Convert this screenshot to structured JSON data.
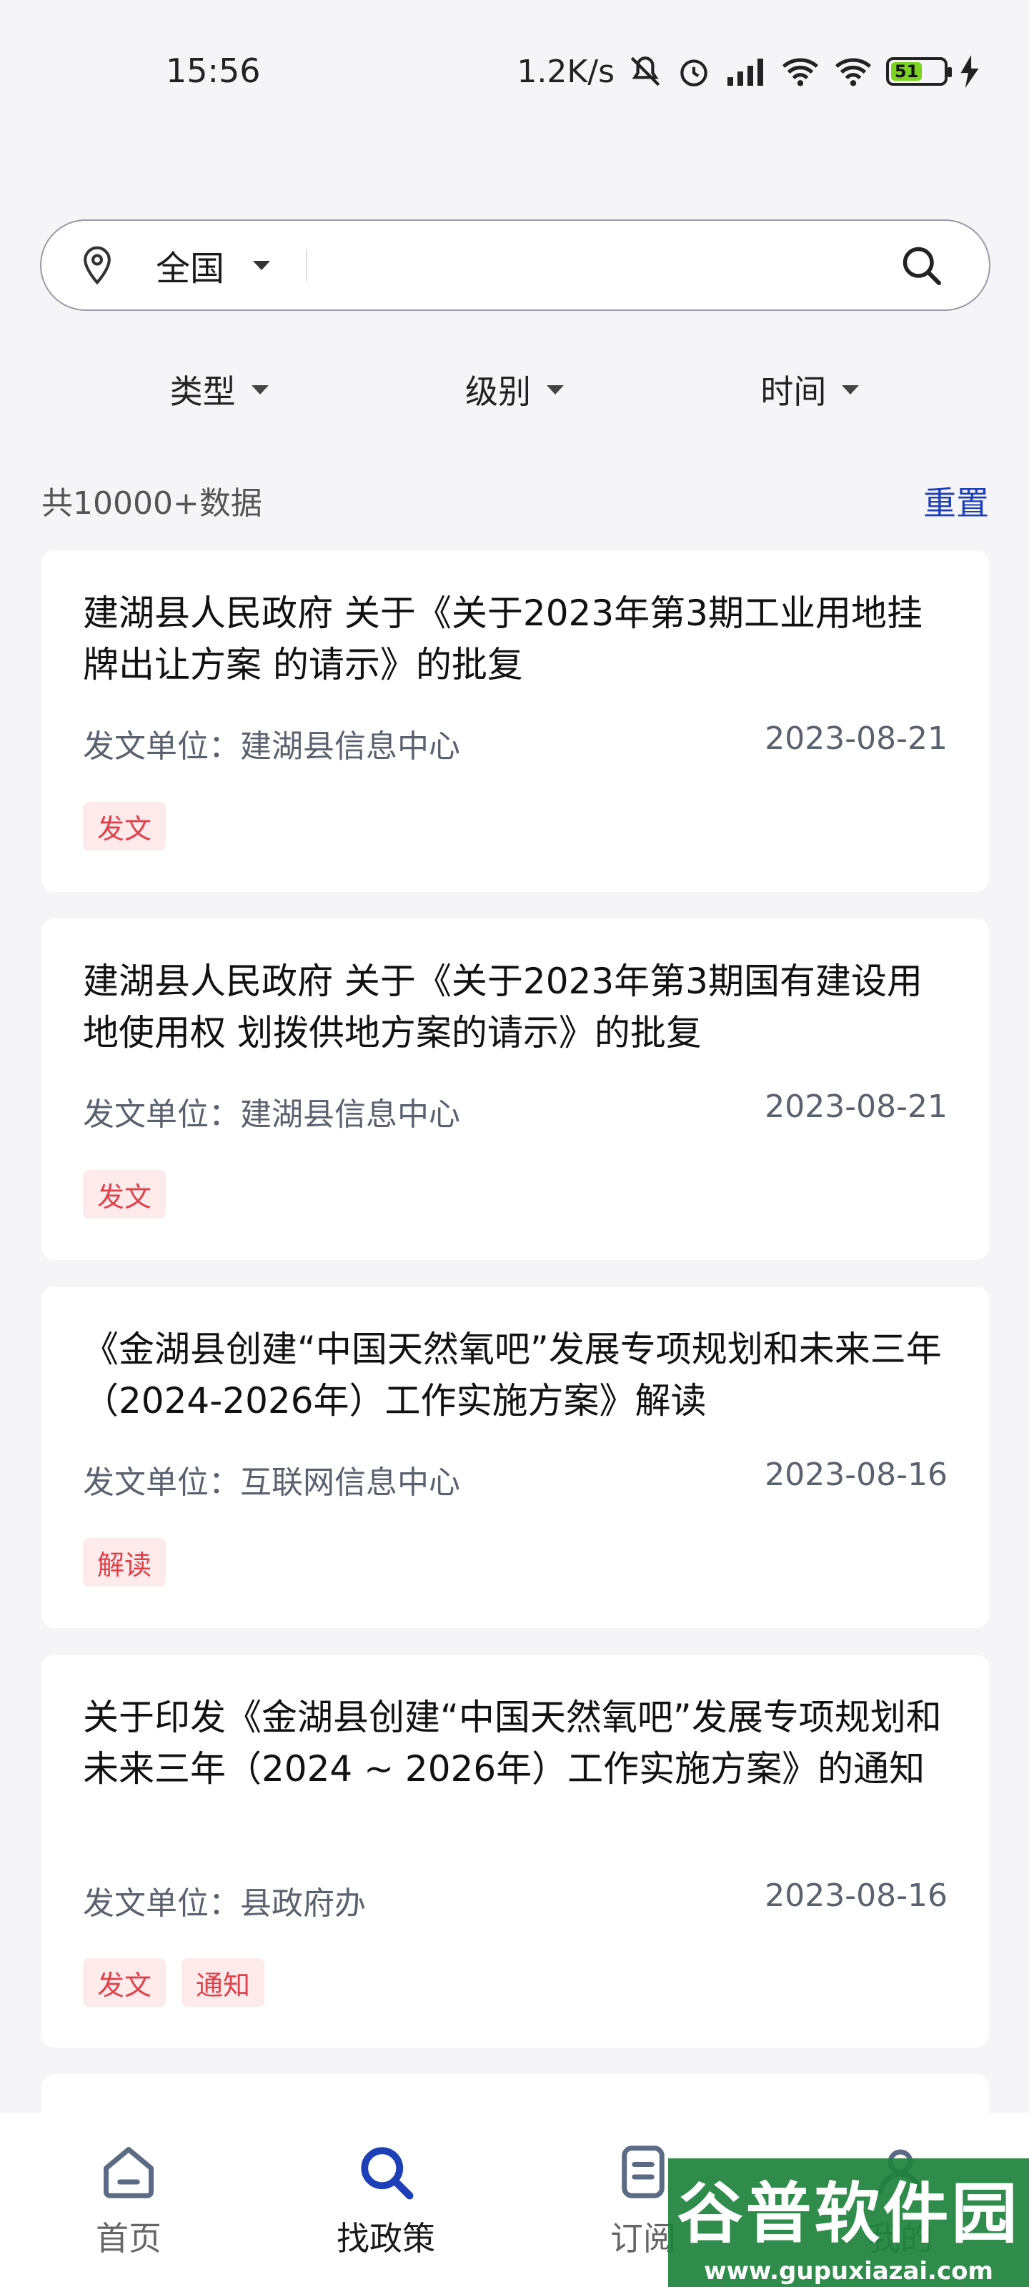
{
  "status_bar": {
    "time": "15:56",
    "speed": "1.2K/s",
    "battery": "51",
    "icons": [
      "mute-icon",
      "alarm-icon",
      "hd-signal-icon",
      "wifi-icon",
      "wifi-icon",
      "battery-icon",
      "charging-icon"
    ]
  },
  "search": {
    "region": "全国",
    "placeholder": "",
    "icon": "search-icon"
  },
  "filters": [
    {
      "label": "类型"
    },
    {
      "label": "级别"
    },
    {
      "label": "时间"
    }
  ],
  "summary": {
    "count_text": "共10000+数据",
    "reset_label": "重置"
  },
  "cards": [
    {
      "title": "建湖县人民政府 关于《关于2023年第3期工业用地挂牌出让方案 的请示》的批复",
      "issuer": "发文单位：建湖县信息中心",
      "date": "2023-08-21",
      "tags": [
        "发文"
      ]
    },
    {
      "title": "建湖县人民政府 关于《关于2023年第3期国有建设用地使用权 划拨供地方案的请示》的批复",
      "issuer": "发文单位：建湖县信息中心",
      "date": "2023-08-21",
      "tags": [
        "发文"
      ]
    },
    {
      "title": "《金湖县创建“中国天然氧吧”发展专项规划和未来三年（2024-2026年）工作实施方案》解读",
      "issuer": "发文单位：互联网信息中心",
      "date": "2023-08-16",
      "tags": [
        "解读"
      ]
    },
    {
      "title": "关于印发《金湖县创建“中国天然氧吧”发展专项规划和未来三年（2024 ~ 2026年）工作实施方案》的通知",
      "issuer": "发文单位：县政府办",
      "date": "2023-08-16",
      "tags": [
        "发文",
        "通知"
      ]
    }
  ],
  "bottom_nav": [
    {
      "label": "首页",
      "icon": "home-icon"
    },
    {
      "label": "找政策",
      "icon": "search-icon",
      "active": true
    },
    {
      "label": "订阅",
      "icon": "document-icon"
    },
    {
      "label": "我的",
      "icon": "profile-icon"
    }
  ],
  "watermark": {
    "title": "谷普软件园",
    "url": "www.gupuxiazai.com"
  },
  "colors": {
    "accent": "#1d3fb8",
    "tag_bg": "#fdeaea",
    "tag_text": "#e0404a",
    "background": "#f5f5f7"
  }
}
